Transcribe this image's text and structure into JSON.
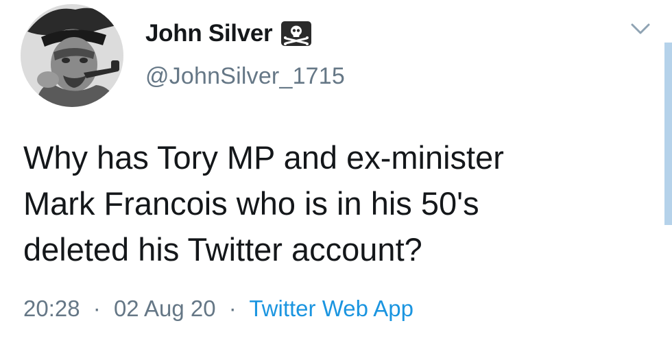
{
  "user": {
    "display_name": "John Silver",
    "handle": "@JohnSilver_1715",
    "name_emoji": "pirate-flag-icon"
  },
  "tweet": {
    "lines": [
      "Why has Tory MP and ex-minister",
      "Mark Francois who is in his 50's",
      "deleted his Twitter account?"
    ]
  },
  "meta": {
    "time": "20:28",
    "separator": "·",
    "date": "02 Aug 20",
    "source": "Twitter Web App"
  },
  "colors": {
    "text": "#14171a",
    "secondary": "#657786",
    "link": "#1b95e0",
    "scrollbar": "#b5d2ea"
  }
}
